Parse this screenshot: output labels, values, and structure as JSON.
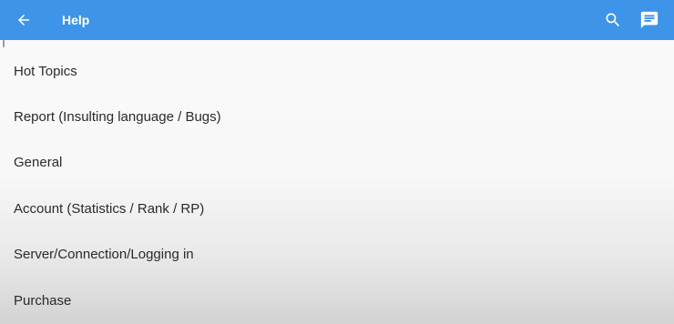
{
  "app_bar": {
    "title": "Help",
    "color": "#3d94e8",
    "back_icon": "arrow-left-icon",
    "actions": [
      "search-icon",
      "chat-message-icon"
    ]
  },
  "help_topics": [
    {
      "label": "Hot Topics"
    },
    {
      "label": "Report (Insulting language / Bugs)"
    },
    {
      "label": "General"
    },
    {
      "label": "Account (Statistics / Rank / RP)"
    },
    {
      "label": "Server/Connection/Logging in"
    },
    {
      "label": "Purchase"
    }
  ]
}
